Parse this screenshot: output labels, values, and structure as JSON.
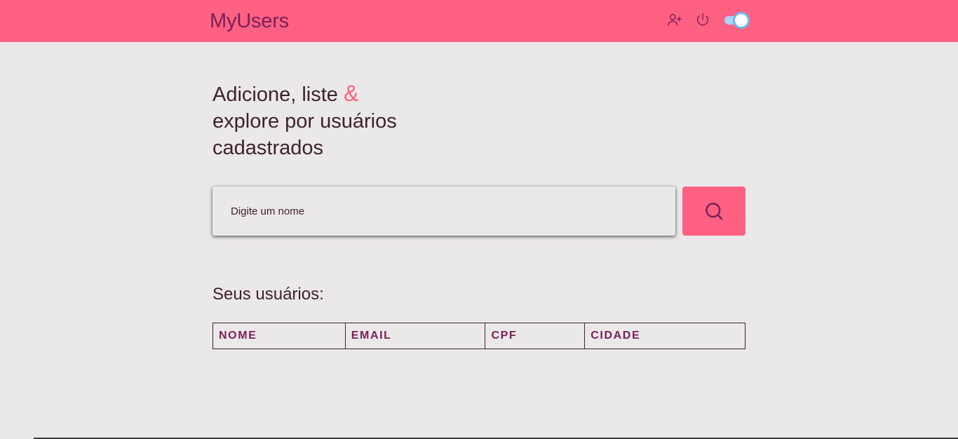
{
  "header": {
    "brand": "MyUsers",
    "icons": {
      "add_user": "add-user-icon",
      "power": "power-icon"
    },
    "theme_toggle_on": true
  },
  "hero": {
    "line1": "Adicione, liste ",
    "amp": "&",
    "line2": "explore por usuários",
    "line3": "cadastrados"
  },
  "search": {
    "placeholder": "Digite um nome",
    "value": "",
    "button_icon": "search-icon"
  },
  "users_section": {
    "title": "Seus usuários:",
    "columns": [
      "NOME",
      "EMAIL",
      "CPF",
      "CIDADE"
    ],
    "rows": []
  },
  "colors": {
    "accent": "#ff6183",
    "brand_text": "#7a2158",
    "body_text": "#3d2230",
    "background": "#ebe8e9",
    "toggle_knob_border": "#6db6ee"
  }
}
